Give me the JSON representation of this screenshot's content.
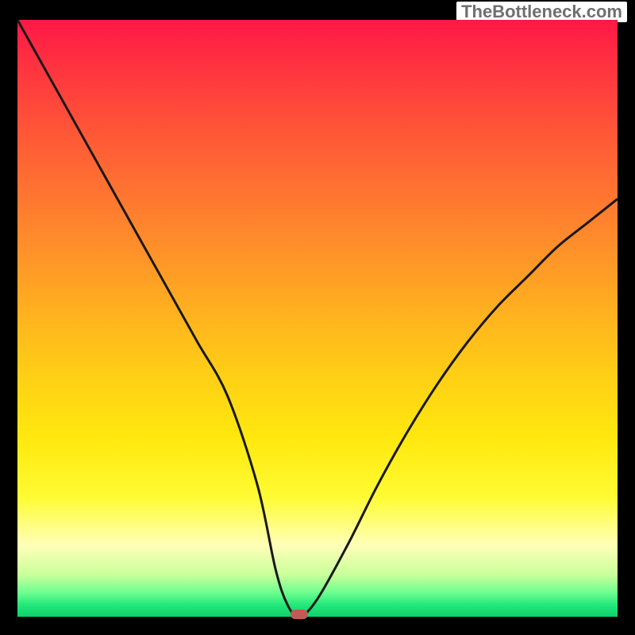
{
  "watermark": "TheBottleneck.com",
  "colors": {
    "curve": "#181818",
    "dot": "#c15a55",
    "background": "#000000"
  },
  "chart_data": {
    "type": "line",
    "title": "",
    "xlabel": "",
    "ylabel": "",
    "xlim": [
      0,
      100
    ],
    "ylim": [
      0,
      100
    ],
    "series": [
      {
        "name": "curve",
        "x": [
          0,
          5,
          10,
          15,
          20,
          25,
          30,
          35,
          40,
          43,
          45,
          47,
          50,
          55,
          60,
          65,
          70,
          75,
          80,
          85,
          90,
          95,
          100
        ],
        "values": [
          100,
          91,
          82,
          73,
          64,
          55,
          46,
          37,
          22,
          8,
          2,
          0,
          3,
          12,
          22,
          31,
          39,
          46,
          52,
          57,
          62,
          66,
          70
        ]
      }
    ],
    "marker": {
      "x": 47,
      "y": 0
    },
    "gradient_stops": [
      {
        "pos": 0,
        "color": "#ff1846"
      },
      {
        "pos": 50,
        "color": "#ffb41e"
      },
      {
        "pos": 80,
        "color": "#fffb33"
      },
      {
        "pos": 100,
        "color": "#0fd06c"
      }
    ]
  }
}
